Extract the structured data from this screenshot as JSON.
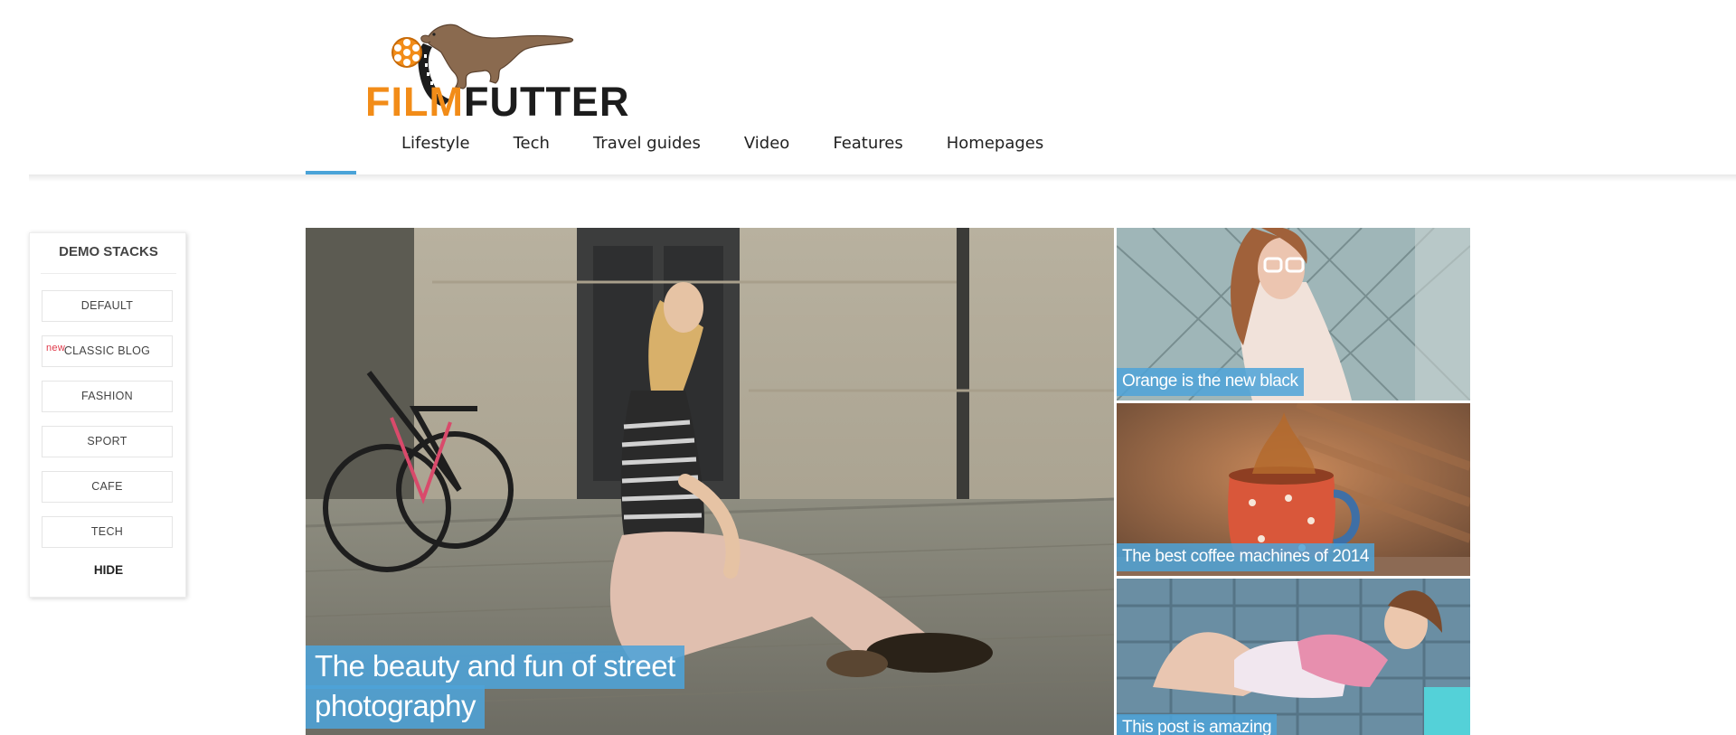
{
  "header": {
    "logo": {
      "part1": "FILM",
      "part2": "FUTTER"
    },
    "nav": [
      "Lifestyle",
      "Tech",
      "Travel guides",
      "Video",
      "Features",
      "Homepages"
    ]
  },
  "demo_stacks": {
    "title": "DEMO STACKS",
    "items": [
      {
        "label": "DEFAULT",
        "badge": ""
      },
      {
        "label": "CLASSIC BLOG",
        "badge": "new"
      },
      {
        "label": "FASHION",
        "badge": ""
      },
      {
        "label": "SPORT",
        "badge": ""
      },
      {
        "label": "CAFE",
        "badge": ""
      },
      {
        "label": "TECH",
        "badge": ""
      }
    ],
    "hide_label": "HIDE"
  },
  "featured": {
    "hero": {
      "line1": "The beauty and fun of street",
      "line2": "photography"
    },
    "side": [
      {
        "title": "Orange is the new black"
      },
      {
        "title": "The best coffee machines of 2014"
      },
      {
        "title": "This post is amazing"
      }
    ]
  },
  "colors": {
    "accent": "#4aa3d8",
    "logo_orange": "#f28c18"
  }
}
